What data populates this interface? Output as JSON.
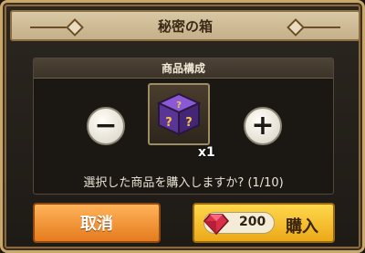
{
  "dialog": {
    "title": "秘密の箱",
    "section_header": "商品構成",
    "item": {
      "icon": "mystery-box-icon",
      "quantity": "x1"
    },
    "question": "選択した商品を購入しますか? (1/10)",
    "minus_label": "−",
    "plus_label": "+",
    "cancel_label": "取消",
    "buy": {
      "price": "200",
      "label": "購入",
      "currency_icon": "ruby-gem-icon"
    }
  },
  "colors": {
    "frame": "#c9a86a",
    "cancel": "#e67b1e",
    "buy": "#eba91a",
    "gem": "#d9304a",
    "box_purple": "#6a3fb5"
  }
}
